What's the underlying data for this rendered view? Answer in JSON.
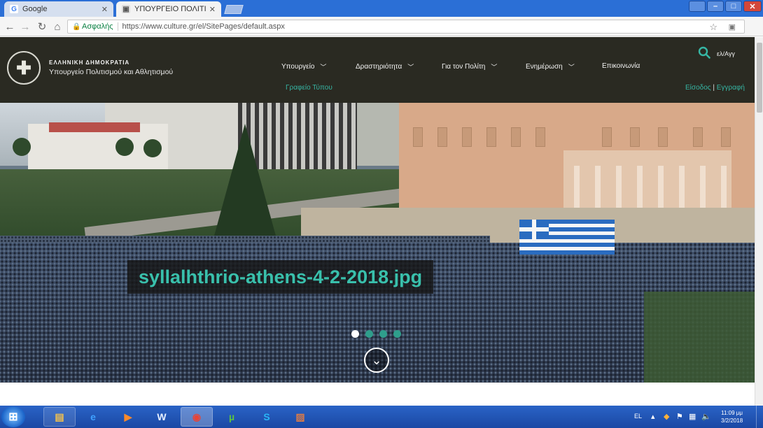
{
  "browser": {
    "tabs": [
      {
        "title": "Google",
        "favicon": "G"
      },
      {
        "title": "ΥΠΟΥΡΓΕΙΟ ΠΟΛΙΤΙΣΜΟ",
        "favicon": "▣"
      }
    ],
    "secure_label": "Ασφαλής",
    "url": "https://www.culture.gr/el/SitePages/default.aspx"
  },
  "site": {
    "org_line_1": "ΕΛΛΗΝΙΚΗ ΔΗΜΟΚΡΑΤΙΑ",
    "org_line_2": "Υπουργείο Πολιτισμού και Αθλητισμού",
    "nav": [
      "Υπουργείο",
      "Δραστηριότητα",
      "Για τον Πολίτη",
      "Ενημέρωση",
      "Επικοινωνία"
    ],
    "press_office": "Γραφείο Τύπου",
    "lang_switch": "ελ/Αγγ",
    "login": "Είσοδος",
    "register": "Εγγραφή",
    "accent_color": "#36b6a4",
    "header_bg": "#2a2a22"
  },
  "hero": {
    "caption": "syllalhthrio-athens-4-2-2018.jpg",
    "slide_count": 4,
    "active_slide": 1
  },
  "taskbar": {
    "language": "EL",
    "clock_time": "11:09 μμ",
    "clock_date": "3/2/2018"
  }
}
